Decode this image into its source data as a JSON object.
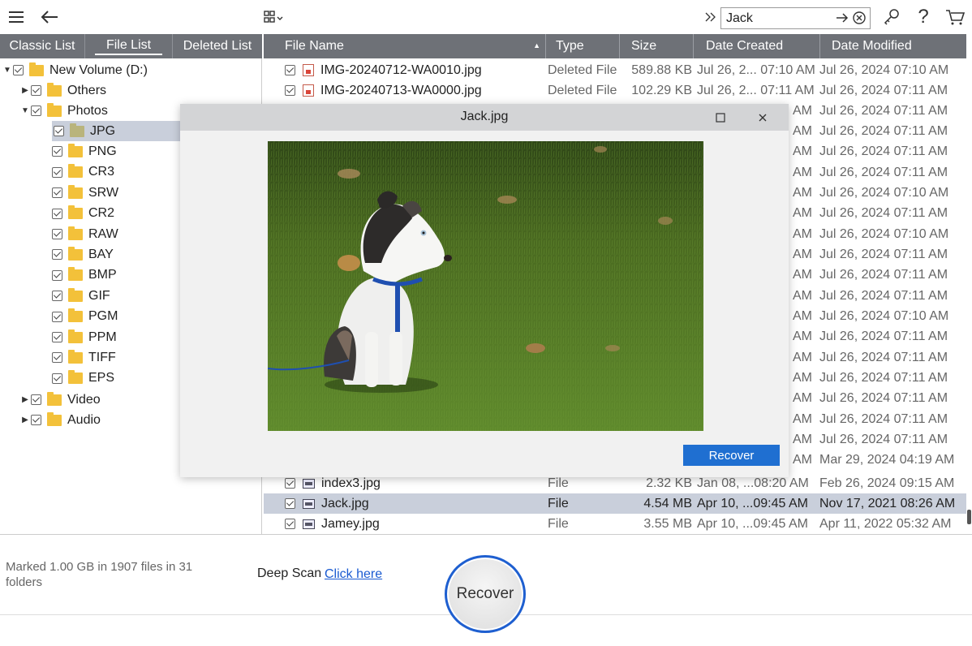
{
  "toolbar": {
    "menu_icon": "hamburger-menu-icon",
    "back_icon": "back-arrow-icon",
    "view_icon": "grid-view-icon",
    "search_value": "Jack",
    "colors": {
      "accent": "#1f6fd1",
      "header": "#6e7177",
      "selection": "#c9cfdb"
    }
  },
  "tabs": [
    {
      "label": "Classic List"
    },
    {
      "label": "File List"
    },
    {
      "label": "Deleted List"
    }
  ],
  "tree": {
    "root": "New Volume (D:)",
    "others": "Others",
    "photos": "Photos",
    "photo_types": [
      "JPG",
      "PNG",
      "CR3",
      "SRW",
      "CR2",
      "RAW",
      "BAY",
      "BMP",
      "GIF",
      "PGM",
      "PPM",
      "TIFF",
      "EPS"
    ],
    "video": "Video",
    "audio": "Audio"
  },
  "columns": {
    "name": "File Name",
    "type": "Type",
    "size": "Size",
    "created": "Date Created",
    "modified": "Date Modified"
  },
  "files_top": [
    {
      "name": "IMG-20240712-WA0010.jpg",
      "type": "Deleted File",
      "size": "589.88 KB",
      "created": "Jul 26, 2... 07:10 AM",
      "modified": "Jul 26, 2024 07:10 AM"
    },
    {
      "name": "IMG-20240713-WA0000.jpg",
      "type": "Deleted File",
      "size": "102.29 KB",
      "created": "Jul 26, 2... 07:11 AM",
      "modified": "Jul 26, 2024 07:11 AM"
    }
  ],
  "hidden_rows": [
    {
      "created_tail": "AM",
      "modified": "Jul 26, 2024 07:11 AM"
    },
    {
      "created_tail": "AM",
      "modified": "Jul 26, 2024 07:11 AM"
    },
    {
      "created_tail": "AM",
      "modified": "Jul 26, 2024 07:11 AM"
    },
    {
      "created_tail": "AM",
      "modified": "Jul 26, 2024 07:11 AM"
    },
    {
      "created_tail": "AM",
      "modified": "Jul 26, 2024 07:10 AM"
    },
    {
      "created_tail": "AM",
      "modified": "Jul 26, 2024 07:11 AM"
    },
    {
      "created_tail": "AM",
      "modified": "Jul 26, 2024 07:10 AM"
    },
    {
      "created_tail": "AM",
      "modified": "Jul 26, 2024 07:11 AM"
    },
    {
      "created_tail": "AM",
      "modified": "Jul 26, 2024 07:11 AM"
    },
    {
      "created_tail": "AM",
      "modified": "Jul 26, 2024 07:11 AM"
    },
    {
      "created_tail": "AM",
      "modified": "Jul 26, 2024 07:10 AM"
    },
    {
      "created_tail": "AM",
      "modified": "Jul 26, 2024 07:11 AM"
    },
    {
      "created_tail": "AM",
      "modified": "Jul 26, 2024 07:11 AM"
    },
    {
      "created_tail": "AM",
      "modified": "Jul 26, 2024 07:11 AM"
    },
    {
      "created_tail": "AM",
      "modified": "Jul 26, 2024 07:11 AM"
    },
    {
      "created_tail": "AM",
      "modified": "Jul 26, 2024 07:11 AM"
    },
    {
      "created_tail": "AM",
      "modified": "Jul 26, 2024 07:11 AM"
    },
    {
      "created_tail": "AM",
      "modified": "Mar 29, 2024 04:19 AM"
    }
  ],
  "files_bottom": [
    {
      "name": "index3.jpg",
      "type": "File",
      "size": "2.32 KB",
      "created": "Jan 08, ...08:20 AM",
      "modified": "Feb 26, 2024 09:15 AM"
    },
    {
      "name": "Jack.jpg",
      "type": "File",
      "size": "4.54 MB",
      "created": "Apr 10, ...09:45 AM",
      "modified": "Nov 17, 2021 08:26 AM"
    },
    {
      "name": "Jamey.jpg",
      "type": "File",
      "size": "3.55 MB",
      "created": "Apr 10, ...09:45 AM",
      "modified": "Apr 11, 2022 05:32 AM"
    }
  ],
  "preview": {
    "title": "Jack.jpg",
    "maximize_icon": "maximize-icon",
    "close_icon": "close-icon",
    "recover_label": "Recover"
  },
  "bottom": {
    "marked_text": "Marked 1.00 GB in 1907 files in 31 folders",
    "deep_scan_label": "Deep Scan",
    "deep_scan_link": "Click here",
    "recover_label": "Recover"
  }
}
